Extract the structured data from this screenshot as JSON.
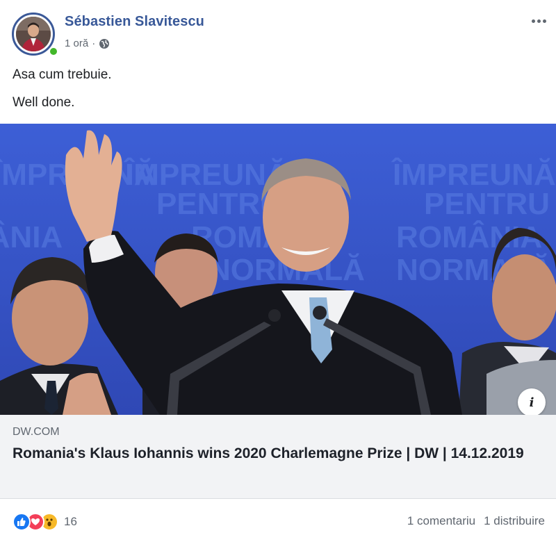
{
  "post": {
    "author": "Sébastien Slavitescu",
    "time": "1 oră",
    "separator": "·",
    "privacy_icon": "globe-icon",
    "more_icon": "more-options-icon",
    "text_lines": [
      "Asa cum trebuie.",
      "Well done."
    ]
  },
  "link_preview": {
    "image_banner_text": [
      "ÎMPREUNĂ",
      "PENTRU",
      "ROMÂNIA",
      "NORMALĂ"
    ],
    "info_label": "i",
    "domain": "DW.COM",
    "title": "Romania's Klaus Iohannis wins 2020 Charlemagne Prize | DW | 14.12.2019"
  },
  "footer": {
    "reaction_icons": [
      "like-icon",
      "love-icon",
      "wow-icon"
    ],
    "reaction_count": "16",
    "comments": "1 comentariu",
    "shares": "1 distribuire"
  },
  "colors": {
    "author_blue": "#385898",
    "image_blue": "#3d57c9",
    "online_green": "#42b72a",
    "like_blue": "#1877f2",
    "love_red": "#f33e58",
    "wow_yellow": "#f7b928"
  }
}
